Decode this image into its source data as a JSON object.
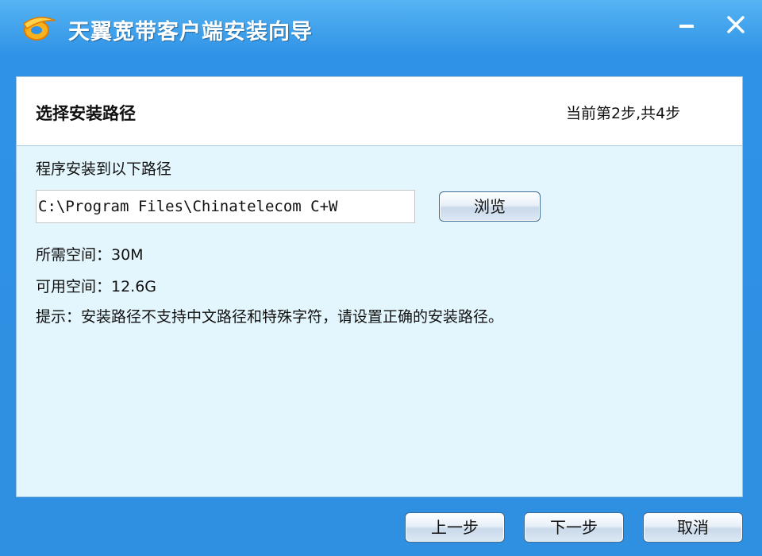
{
  "window": {
    "title": "天翼宽带客户端安装向导"
  },
  "titlebar": {
    "logo_icon": "chinatelecom-logo-icon",
    "minimize_icon": "minimize-icon",
    "close_icon": "close-icon"
  },
  "header": {
    "title": "选择安装路径",
    "step": "当前第2步,共4步"
  },
  "body": {
    "path_label": "程序安装到以下路径",
    "path_value": "C:\\Program Files\\Chinatelecom C+W",
    "browse_label": "浏览",
    "required_space": "所需空间：30M",
    "available_space": "可用空间：12.6G",
    "hint": "提示：安装路径不支持中文路径和特殊字符，请设置正确的安装路径。"
  },
  "footer": {
    "prev_label": "上一步",
    "next_label": "下一步",
    "cancel_label": "取消"
  },
  "colors": {
    "titlebar_blue": "#2f8fe0",
    "panel_background": "#e4f6fd",
    "logo_orange": "#f5a623"
  }
}
